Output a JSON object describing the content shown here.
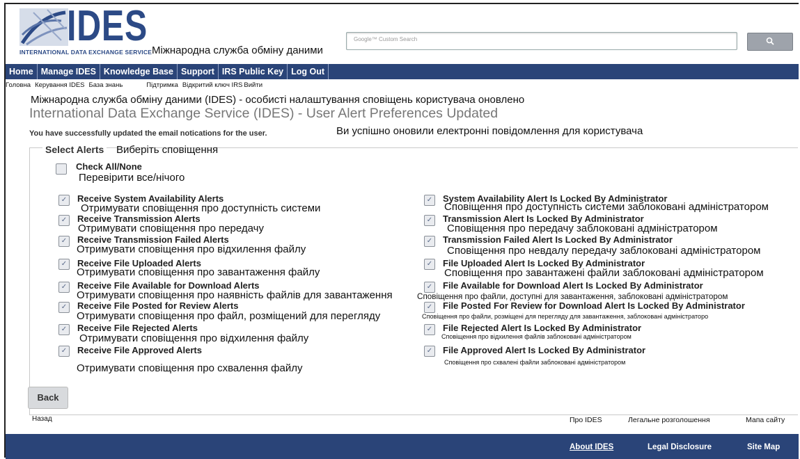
{
  "header": {
    "logo_text": "IDES",
    "logo_subtitle": "INTERNATIONAL DATA EXCHANGE SERVICE",
    "tagline_uk": "Міжнародна служба обміну даними",
    "search_placeholder": "Google™ Custom Search",
    "search_button_icon": "search-icon"
  },
  "nav": {
    "items": [
      "Home",
      "Manage IDES",
      "Knowledge Base",
      "Support",
      "IRS Public Key",
      "Log Out"
    ],
    "translations": [
      "Головна",
      "Керування IDES",
      "База знань",
      "Підтримка",
      "Відкритий ключ IRS",
      "Вийти"
    ]
  },
  "page": {
    "title_uk": "Міжнародна служба обміну даними (IDES) - особисті налаштування сповіщень користувача оновлено",
    "title_en": "International Data Exchange Service (IDES) - User Alert Preferences Updated",
    "success_en": "You have successfully updated the email notications for the user.",
    "success_uk": "Ви успішно оновили електронні повідомлення для користувача"
  },
  "alerts": {
    "legend": "Select Alerts",
    "legend_uk": "Виберіть сповіщення",
    "check_all": "Check All/None",
    "check_all_uk": "Перевірити все/нічого",
    "left": [
      {
        "label": "Receive System Availability Alerts",
        "uk": "Отримувати сповіщення про доступність системи",
        "checked": true
      },
      {
        "label": "Receive Transmission Alerts",
        "uk": "Отримувати сповіщення про передачу",
        "checked": true
      },
      {
        "label": "Receive Transmission Failed Alerts",
        "uk": "Отримувати сповіщення про відхилення файлу",
        "checked": true
      },
      {
        "label": "Receive File Uploaded Alerts",
        "uk": "Отримувати сповіщення про завантаження файлу",
        "checked": true
      },
      {
        "label": "Receive File Available for Download Alerts",
        "uk": "Отримувати сповіщення про наявність файлів для завантаження",
        "checked": true
      },
      {
        "label": "Receive File Posted for Review Alerts",
        "uk": "Отримувати сповіщення про файл, розміщений для перегляду",
        "checked": true
      },
      {
        "label": "Receive File Rejected Alerts",
        "uk": "Отримувати сповіщення про відхилення файлу",
        "checked": true
      },
      {
        "label": "Receive File Approved Alerts",
        "uk": "Отримувати сповіщення про схвалення файлу",
        "checked": true
      }
    ],
    "right": [
      {
        "label": "System Availability Alert Is Locked By Administrator",
        "uk": "Сповіщення про доступність системи заблоковані адміністратором",
        "checked": true
      },
      {
        "label": "Transmission Alert Is Locked By Administrator",
        "uk": "Сповіщення про передачу заблоковані адміністратором",
        "checked": true
      },
      {
        "label": "Transmission Failed Alert Is Locked By Administrator",
        "uk": "Сповіщення про невдалу передачу заблоковані адміністратором",
        "checked": true
      },
      {
        "label": "File Uploaded Alert Is Locked By Administrator",
        "uk": "Сповіщення про завантажені файли заблоковані адміністратором",
        "checked": true
      },
      {
        "label": "File Available for Download Alert Is Locked By Administrator",
        "uk": "Сповіщення про файли, доступні для завантаження, заблоковані адміністратором",
        "checked": true
      },
      {
        "label": "File Posted For Review for Download Alert Is Locked By Administrator",
        "uk": "Сповіщення про файли, розміщені для перегляду для завантаження, заблоковані адміністраторо",
        "checked": true
      },
      {
        "label": "File Rejected Alert Is Locked By Administrator",
        "uk": "Сповіщення про відхилення файлів заблоковані адміністратором",
        "checked": true
      },
      {
        "label": "File Approved Alert Is Locked By Administrator",
        "uk": "Сповіщення про схвалені файли заблоковані адміністратором",
        "checked": true
      }
    ]
  },
  "actions": {
    "back": "Back",
    "back_uk": "Назад"
  },
  "footer": {
    "links": [
      "About IDES",
      "Legal Disclosure",
      "Site Map"
    ],
    "links_uk": [
      "Про IDES",
      "Легальне розголошення",
      "Мапа сайту"
    ]
  },
  "colors": {
    "nav_bg": "#2a4478",
    "brand": "#2c4a86"
  }
}
